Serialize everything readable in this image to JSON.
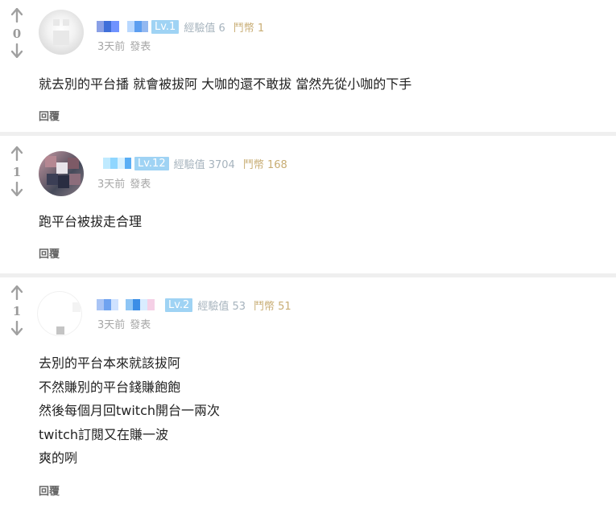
{
  "comments": [
    {
      "votes": "0",
      "level": "Lv.1",
      "exp": "經驗值 6",
      "coins": "鬥幣 1",
      "time": "3天前",
      "action": "發表",
      "lines": [
        "就去別的平台播 就會被拔阿 大咖的還不敢拔 當然先從小咖的下手"
      ],
      "reply_label": "回覆"
    },
    {
      "votes": "1",
      "level": "Lv.12",
      "exp": "經驗值 3704",
      "coins": "鬥幣 168",
      "time": "3天前",
      "action": "發表",
      "lines": [
        "跑平台被拔走合理"
      ],
      "reply_label": "回覆"
    },
    {
      "votes": "1",
      "level": "Lv.2",
      "exp": "經驗值 53",
      "coins": "鬥幣 51",
      "time": "3天前",
      "action": "發表",
      "lines": [
        "去別的平台本來就該拔阿",
        "不然賺別的平台錢賺飽飽",
        "然後每個月回twitch開台一兩次",
        "twitch訂閱又在賺一波",
        "爽的咧"
      ],
      "reply_label": "回覆"
    }
  ],
  "icons": {
    "upvote": "arrow-up-icon",
    "downvote": "arrow-down-icon"
  },
  "colors": {
    "level_badge": "#9fd3f4",
    "exp_text": "#a6b3bd",
    "coin_text": "#c8ad74",
    "meta_gray": "#a7a7a7",
    "separator": "#efefef"
  }
}
